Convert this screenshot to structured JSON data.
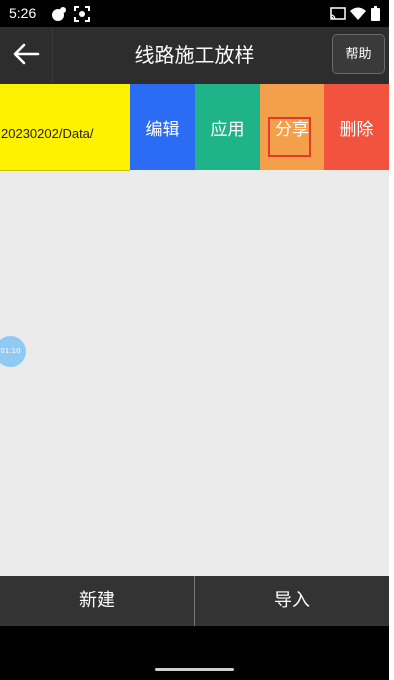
{
  "status_bar": {
    "time": "5:26",
    "left_icons": [
      "notification-icon",
      "screen-capture-icon"
    ],
    "right_icons": [
      "cast-icon",
      "wifi-icon",
      "battery-icon"
    ]
  },
  "app_bar": {
    "title": "线路施工放样",
    "help_label": "帮助",
    "back_icon": "back-arrow-icon"
  },
  "list_item": {
    "path": "20230202/Data/",
    "actions": {
      "edit": "编辑",
      "apply": "应用",
      "share": "分享",
      "delete": "删除"
    },
    "highlighted_action": "share"
  },
  "floating_bubble": {
    "label": "01:10"
  },
  "bottom_bar": {
    "new_label": "新建",
    "import_label": "导入"
  },
  "colors": {
    "path_bg": "#fff200",
    "edit": "#2a6df4",
    "apply": "#1fb389",
    "share": "#f4a04a",
    "delete": "#f2533e",
    "highlight_border": "#e03a2e"
  }
}
